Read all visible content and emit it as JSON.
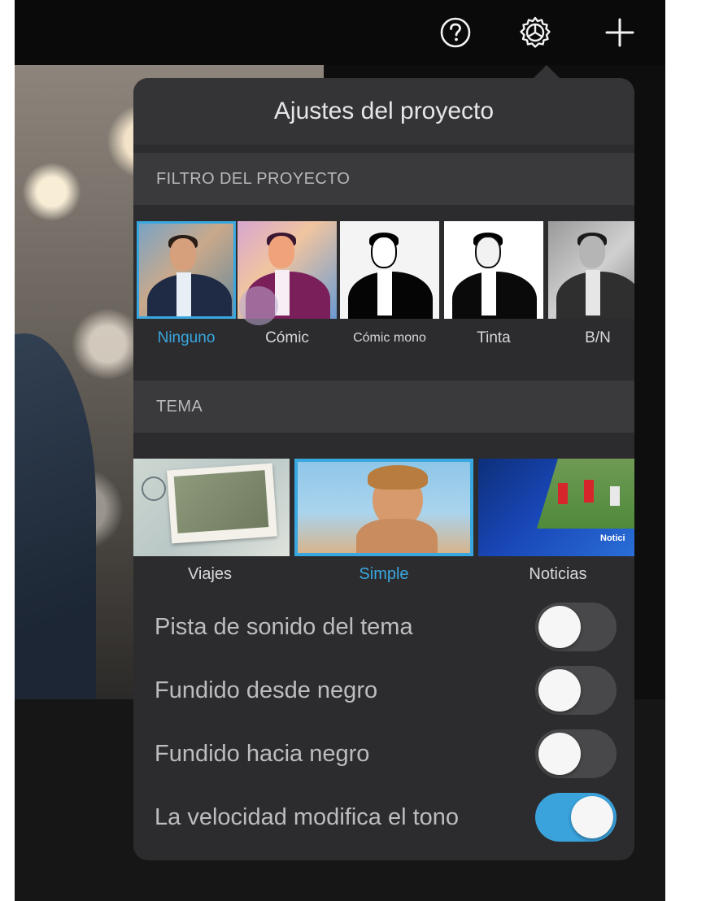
{
  "topbar": {
    "help_icon": "help-circle-icon",
    "settings_icon": "gear-icon",
    "add_icon": "plus-icon"
  },
  "panel": {
    "title": "Ajustes del proyecto",
    "filter_section_label": "FILTRO DEL PROYECTO",
    "filters": [
      {
        "label": "Ninguno",
        "selected": true
      },
      {
        "label": "Cómic",
        "selected": false
      },
      {
        "label": "Cómic mono",
        "selected": false
      },
      {
        "label": "Tinta",
        "selected": false
      },
      {
        "label": "B/N",
        "selected": false
      }
    ],
    "theme_section_label": "TEMA",
    "themes": [
      {
        "label": "Viajes",
        "selected": false
      },
      {
        "label": "Simple",
        "selected": true
      },
      {
        "label": "Noticias",
        "selected": false,
        "overlay_text": "Notici"
      }
    ],
    "toggles": [
      {
        "label": "Pista de sonido del tema",
        "on": false
      },
      {
        "label": "Fundido desde negro",
        "on": false
      },
      {
        "label": "Fundido hacia negro",
        "on": false
      },
      {
        "label": "La velocidad modifica el tono",
        "on": true
      }
    ]
  },
  "colors": {
    "accent": "#39a7e0",
    "panel_bg": "#2c2c2e",
    "toggle_on": "#3aa3dc"
  }
}
